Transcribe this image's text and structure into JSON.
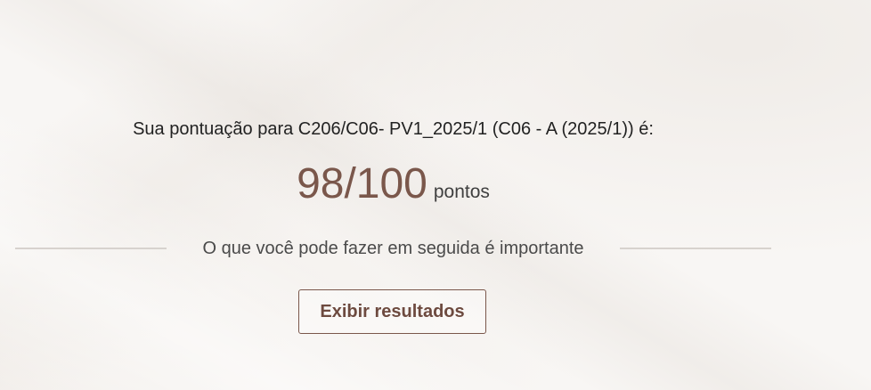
{
  "result": {
    "heading": "Sua pontuação para C206/C06- PV1_2025/1 (C06 - A (2025/1)) é:",
    "score": "98/100",
    "score_unit": "pontos",
    "progress_fraction": 0.98
  },
  "next_steps": {
    "label": "O que você pode fazer em seguida é importante"
  },
  "actions": {
    "view_results_label": "Exibir resultados"
  },
  "colors": {
    "accent": "#7a574b",
    "background": "#f7f4f1",
    "divider": "#d7d2ce"
  }
}
